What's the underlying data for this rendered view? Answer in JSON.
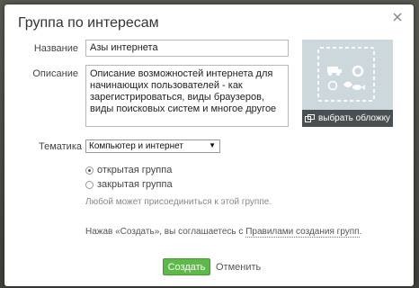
{
  "dialog": {
    "title": "Группа по интересам"
  },
  "form": {
    "name_label": "Название",
    "name_value": "Азы интернета",
    "description_label": "Описание",
    "description_value": "Описание возможностей интернета для начинающих пользователей - как зарегистрироваться, виды браузеров, виды поисковых систем и многое другое",
    "topic_label": "Тематика",
    "topic_value": "Компьютер и интернет"
  },
  "cover": {
    "button_label": "выбрать обложку"
  },
  "privacy": {
    "open_label": "открытая группа",
    "closed_label": "закрытая группа",
    "selected": "open",
    "hint": "Любой может присоединиться к этой группе."
  },
  "terms": {
    "prefix": "Нажав «Создать», вы соглашаетесь с ",
    "link": "Правилами создания групп",
    "suffix": "."
  },
  "actions": {
    "create_label": "Создать",
    "cancel_label": "Отменить"
  },
  "colors": {
    "create_button": "#5fb84a",
    "cover_background": "#ccd8dc",
    "cover_button": "#4a4f52"
  }
}
